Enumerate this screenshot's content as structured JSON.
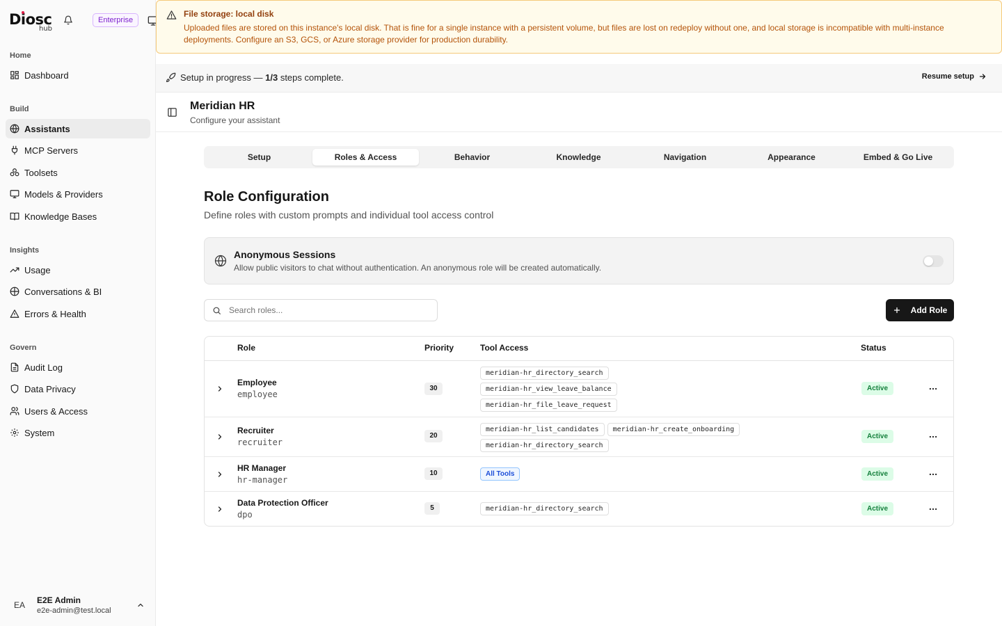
{
  "sidebar": {
    "logo_text": "Diosc",
    "logo_sub": "hub",
    "plan_badge": "Enterprise",
    "groups": [
      {
        "label": "Home",
        "items": [
          {
            "label": "Dashboard",
            "icon": "dashboard-icon"
          }
        ]
      },
      {
        "label": "Build",
        "items": [
          {
            "label": "Assistants",
            "icon": "globe-icon",
            "active": true
          },
          {
            "label": "MCP Servers",
            "icon": "plug-icon"
          },
          {
            "label": "Toolsets",
            "icon": "boxes-icon"
          },
          {
            "label": "Models & Providers",
            "icon": "monitor-icon"
          },
          {
            "label": "Knowledge Bases",
            "icon": "book-icon"
          }
        ]
      },
      {
        "label": "Insights",
        "items": [
          {
            "label": "Usage",
            "icon": "trend-icon"
          },
          {
            "label": "Conversations & BI",
            "icon": "chat-icon"
          },
          {
            "label": "Errors & Health",
            "icon": "alert-icon"
          }
        ]
      },
      {
        "label": "Govern",
        "items": [
          {
            "label": "Audit Log",
            "icon": "file-icon"
          },
          {
            "label": "Data Privacy",
            "icon": "shield-icon"
          },
          {
            "label": "Users & Access",
            "icon": "users-icon"
          },
          {
            "label": "System",
            "icon": "gear-icon"
          }
        ]
      }
    ],
    "user": {
      "initials": "EA",
      "name": "E2E Admin",
      "email": "e2e-admin@test.local"
    }
  },
  "banner": {
    "title": "File storage: local disk",
    "body": "Uploaded files are stored on this instance's local disk. That is fine for a single instance with a persistent volume, but files are lost on redeploy without one, and local storage is incompatible with multi-instance deployments. Configure an S3, GCS, or Azure storage provider for production durability."
  },
  "setup": {
    "prefix": "Setup in progress — ",
    "progress": "1/3",
    "suffix": " steps complete.",
    "resume_label": "Resume setup"
  },
  "page": {
    "title": "Meridian HR",
    "subtitle": "Configure your assistant"
  },
  "tabs": [
    {
      "label": "Setup"
    },
    {
      "label": "Roles & Access",
      "active": true
    },
    {
      "label": "Behavior"
    },
    {
      "label": "Knowledge"
    },
    {
      "label": "Navigation"
    },
    {
      "label": "Appearance"
    },
    {
      "label": "Embed & Go Live"
    }
  ],
  "section": {
    "title": "Role Configuration",
    "subtitle": "Define roles with custom prompts and individual tool access control"
  },
  "anonymous": {
    "title": "Anonymous Sessions",
    "description": "Allow public visitors to chat without authentication. An anonymous role will be created automatically.",
    "enabled": false
  },
  "search": {
    "placeholder": "Search roles...",
    "value": ""
  },
  "add_role_label": "Add Role",
  "table": {
    "headers": {
      "role": "Role",
      "priority": "Priority",
      "tools": "Tool Access",
      "status": "Status"
    },
    "rows": [
      {
        "name": "Employee",
        "slug": "employee",
        "priority": "30",
        "tools": [
          "meridian-hr_directory_search",
          "meridian-hr_view_leave_balance",
          "meridian-hr_file_leave_request"
        ],
        "status": "Active"
      },
      {
        "name": "Recruiter",
        "slug": "recruiter",
        "priority": "20",
        "tools": [
          "meridian-hr_list_candidates",
          "meridian-hr_create_onboarding",
          "meridian-hr_directory_search"
        ],
        "status": "Active"
      },
      {
        "name": "HR Manager",
        "slug": "hr-manager",
        "priority": "10",
        "all_tools_label": "All Tools",
        "tools": [],
        "status": "Active"
      },
      {
        "name": "Data Protection Officer",
        "slug": "dpo",
        "priority": "5",
        "tools": [
          "meridian-hr_directory_search"
        ],
        "status": "Active"
      }
    ]
  }
}
